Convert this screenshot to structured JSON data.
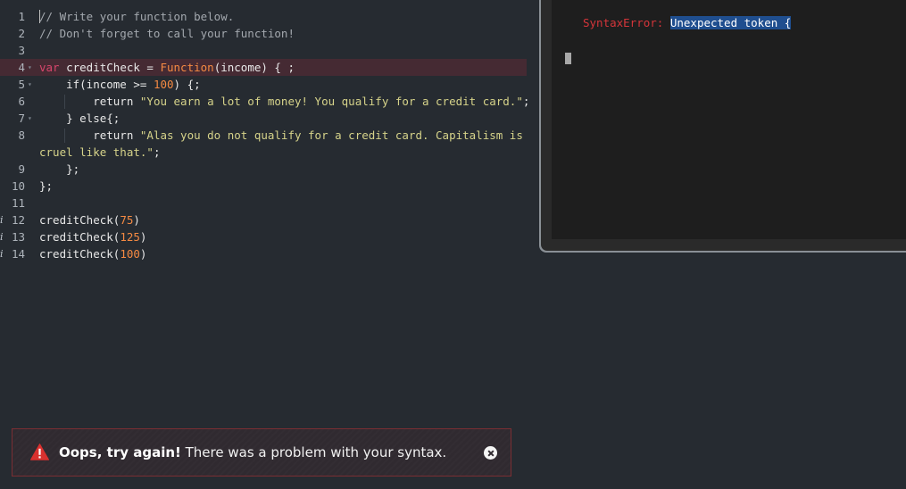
{
  "editor": {
    "gutter_info_marker": "i",
    "lines": [
      {
        "num": "1",
        "tokens": [
          {
            "t": "// Write your function below.",
            "c": "tk-comment"
          }
        ]
      },
      {
        "num": "2",
        "tokens": [
          {
            "t": "// Don't forget to call your function!",
            "c": "tk-comment"
          }
        ]
      },
      {
        "num": "3",
        "tokens": []
      },
      {
        "num": "4",
        "tokens": [
          {
            "t": "var ",
            "c": "tk-kw"
          },
          {
            "t": "creditCheck = ",
            "c": "tk-plain"
          },
          {
            "t": "Function",
            "c": "tk-fn"
          },
          {
            "t": "(income) { ;",
            "c": "tk-plain"
          }
        ]
      },
      {
        "num": "5",
        "tokens": [
          {
            "t": "    if(income >= ",
            "c": "tk-plain"
          },
          {
            "t": "100",
            "c": "tk-num"
          },
          {
            "t": ") {;",
            "c": "tk-plain"
          }
        ]
      },
      {
        "num": "6",
        "tokens": [
          {
            "t": "        return ",
            "c": "tk-plain"
          },
          {
            "t": "\"You earn a lot of money! You qualify for a credit card.\"",
            "c": "tk-str"
          },
          {
            "t": ";",
            "c": "tk-plain"
          }
        ]
      },
      {
        "num": "7",
        "tokens": [
          {
            "t": "    } else{;",
            "c": "tk-plain"
          }
        ]
      },
      {
        "num": "8",
        "tokens": [
          {
            "t": "        return ",
            "c": "tk-plain"
          },
          {
            "t": "\"Alas you do not qualify for a credit card. Capitalism is",
            "c": "tk-str"
          }
        ]
      },
      {
        "num": "",
        "tokens": [
          {
            "t": "cruel like that.\"",
            "c": "tk-str"
          },
          {
            "t": ";",
            "c": "tk-plain"
          }
        ]
      },
      {
        "num": "9",
        "tokens": [
          {
            "t": "    };",
            "c": "tk-plain"
          }
        ]
      },
      {
        "num": "10",
        "tokens": [
          {
            "t": "};",
            "c": "tk-plain"
          }
        ]
      },
      {
        "num": "11",
        "tokens": []
      },
      {
        "num": "12",
        "tokens": [
          {
            "t": "creditCheck(",
            "c": "tk-plain"
          },
          {
            "t": "75",
            "c": "tk-num"
          },
          {
            "t": ")",
            "c": "tk-plain"
          }
        ]
      },
      {
        "num": "13",
        "tokens": [
          {
            "t": "creditCheck(",
            "c": "tk-plain"
          },
          {
            "t": "125",
            "c": "tk-num"
          },
          {
            "t": ")",
            "c": "tk-plain"
          }
        ]
      },
      {
        "num": "14",
        "tokens": [
          {
            "t": "creditCheck(",
            "c": "tk-plain"
          },
          {
            "t": "100",
            "c": "tk-num"
          },
          {
            "t": ")",
            "c": "tk-plain"
          }
        ]
      }
    ]
  },
  "console": {
    "error_type": "SyntaxError:",
    "error_message": "Unexpected token {"
  },
  "banner": {
    "title": "Oops, try again!",
    "message": " There was a problem with your syntax."
  },
  "colors": {
    "editor_bg": "#262b31",
    "active_line": "#452a33",
    "keyword": "#d7466c",
    "number": "#f58a43",
    "string": "#d6d38a",
    "error": "#d5353a"
  }
}
